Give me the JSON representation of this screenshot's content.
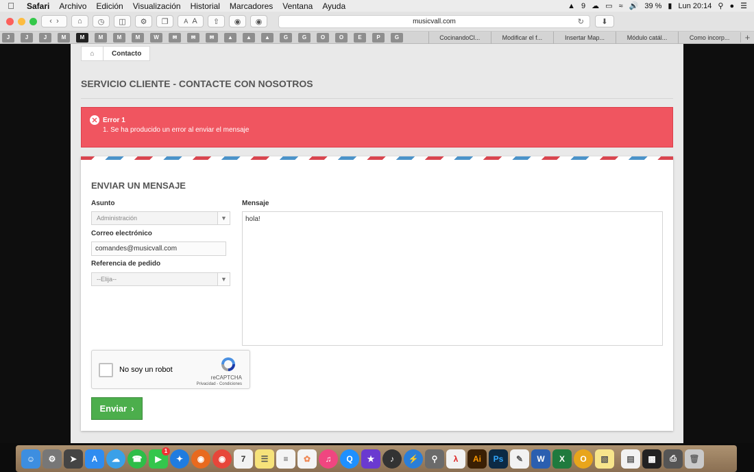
{
  "menubar": {
    "app_name": "Safari",
    "items": [
      "Archivo",
      "Edición",
      "Visualización",
      "Historial",
      "Marcadores",
      "Ventana",
      "Ayuda"
    ],
    "adobe_badge": "9",
    "battery": "39 %",
    "clock": "Lun 20:14"
  },
  "toolbar": {
    "url": "musicvall.com",
    "font_small": "A",
    "font_large": "A"
  },
  "bookmarks": {
    "icons": [
      "J",
      "J",
      "J",
      "M",
      "M",
      "M",
      "M",
      "M",
      "W",
      "✉",
      "✉",
      "✉",
      "▲",
      "▲",
      "▲",
      "G",
      "G",
      "O",
      "O",
      "E",
      "P",
      "G"
    ],
    "tabs": [
      "CocinandoCl...",
      "Modificar el f...",
      "Insertar Map...",
      "Módulo catál...",
      "Como incorp..."
    ],
    "new_tab": "+"
  },
  "breadcrumb": {
    "current": "Contacto"
  },
  "page": {
    "title": "SERVICIO CLIENTE - CONTACTE CON NOSOTROS"
  },
  "alert": {
    "heading": "Error 1",
    "message": "1.  Se ha producido un error al enviar el mensaje"
  },
  "form": {
    "title": "ENVIAR UN MENSAJE",
    "subject_label": "Asunto",
    "subject_value": "Administración",
    "email_label": "Correo electrónico",
    "email_value": "comandes@musicvall.com",
    "order_label": "Referencia de pedido",
    "order_value": "--Elija--",
    "message_label": "Mensaje",
    "message_value": "hola!",
    "submit_label": "Enviar"
  },
  "recaptcha": {
    "label": "No soy un robot",
    "brand": "reCAPTCHA",
    "terms": "Privacidad - Condiciones"
  },
  "dock": {
    "calendar_day": "7",
    "facetime_badge": "1"
  },
  "colors": {
    "alert_bg": "#f05560",
    "submit_bg": "#4cae4c",
    "stripe_red": "#d9454f",
    "stripe_blue": "#4b93c9"
  }
}
